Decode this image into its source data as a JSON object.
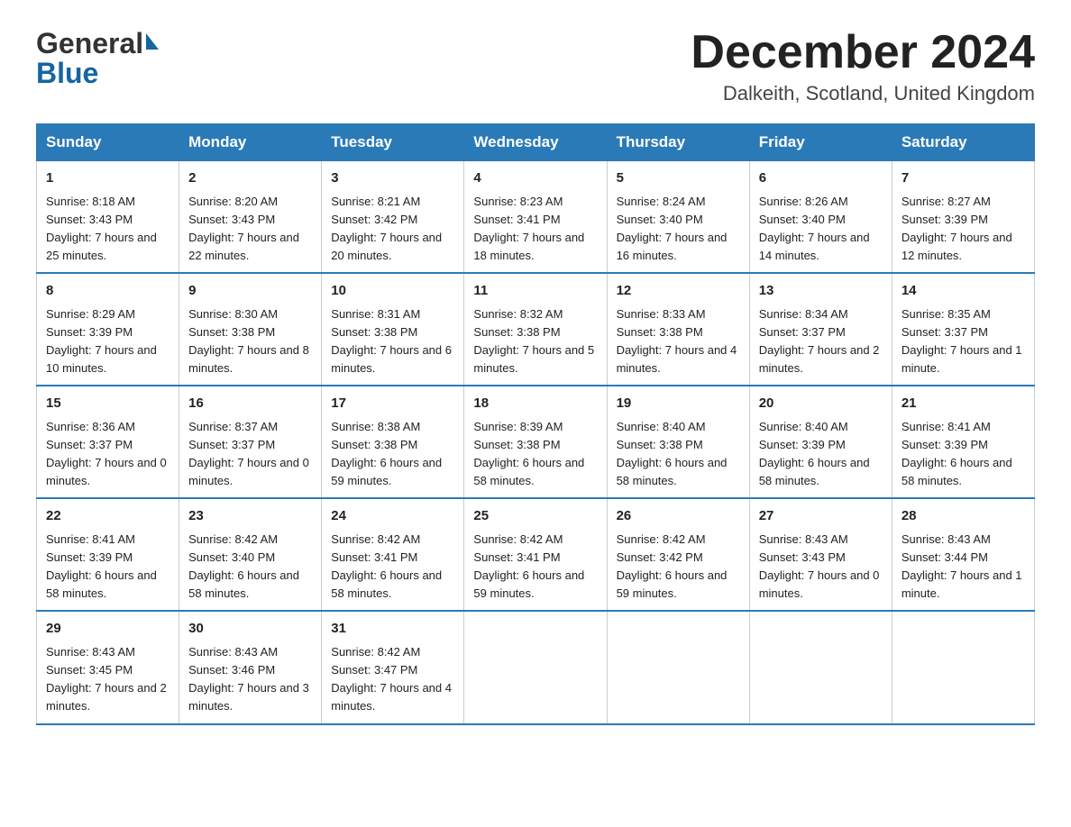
{
  "header": {
    "logo_general": "General",
    "logo_blue": "Blue",
    "month_title": "December 2024",
    "location": "Dalkeith, Scotland, United Kingdom"
  },
  "days_of_week": [
    "Sunday",
    "Monday",
    "Tuesday",
    "Wednesday",
    "Thursday",
    "Friday",
    "Saturday"
  ],
  "weeks": [
    [
      {
        "day": "1",
        "sunrise": "8:18 AM",
        "sunset": "3:43 PM",
        "daylight": "7 hours and 25 minutes."
      },
      {
        "day": "2",
        "sunrise": "8:20 AM",
        "sunset": "3:43 PM",
        "daylight": "7 hours and 22 minutes."
      },
      {
        "day": "3",
        "sunrise": "8:21 AM",
        "sunset": "3:42 PM",
        "daylight": "7 hours and 20 minutes."
      },
      {
        "day": "4",
        "sunrise": "8:23 AM",
        "sunset": "3:41 PM",
        "daylight": "7 hours and 18 minutes."
      },
      {
        "day": "5",
        "sunrise": "8:24 AM",
        "sunset": "3:40 PM",
        "daylight": "7 hours and 16 minutes."
      },
      {
        "day": "6",
        "sunrise": "8:26 AM",
        "sunset": "3:40 PM",
        "daylight": "7 hours and 14 minutes."
      },
      {
        "day": "7",
        "sunrise": "8:27 AM",
        "sunset": "3:39 PM",
        "daylight": "7 hours and 12 minutes."
      }
    ],
    [
      {
        "day": "8",
        "sunrise": "8:29 AM",
        "sunset": "3:39 PM",
        "daylight": "7 hours and 10 minutes."
      },
      {
        "day": "9",
        "sunrise": "8:30 AM",
        "sunset": "3:38 PM",
        "daylight": "7 hours and 8 minutes."
      },
      {
        "day": "10",
        "sunrise": "8:31 AM",
        "sunset": "3:38 PM",
        "daylight": "7 hours and 6 minutes."
      },
      {
        "day": "11",
        "sunrise": "8:32 AM",
        "sunset": "3:38 PM",
        "daylight": "7 hours and 5 minutes."
      },
      {
        "day": "12",
        "sunrise": "8:33 AM",
        "sunset": "3:38 PM",
        "daylight": "7 hours and 4 minutes."
      },
      {
        "day": "13",
        "sunrise": "8:34 AM",
        "sunset": "3:37 PM",
        "daylight": "7 hours and 2 minutes."
      },
      {
        "day": "14",
        "sunrise": "8:35 AM",
        "sunset": "3:37 PM",
        "daylight": "7 hours and 1 minute."
      }
    ],
    [
      {
        "day": "15",
        "sunrise": "8:36 AM",
        "sunset": "3:37 PM",
        "daylight": "7 hours and 0 minutes."
      },
      {
        "day": "16",
        "sunrise": "8:37 AM",
        "sunset": "3:37 PM",
        "daylight": "7 hours and 0 minutes."
      },
      {
        "day": "17",
        "sunrise": "8:38 AM",
        "sunset": "3:38 PM",
        "daylight": "6 hours and 59 minutes."
      },
      {
        "day": "18",
        "sunrise": "8:39 AM",
        "sunset": "3:38 PM",
        "daylight": "6 hours and 58 minutes."
      },
      {
        "day": "19",
        "sunrise": "8:40 AM",
        "sunset": "3:38 PM",
        "daylight": "6 hours and 58 minutes."
      },
      {
        "day": "20",
        "sunrise": "8:40 AM",
        "sunset": "3:39 PM",
        "daylight": "6 hours and 58 minutes."
      },
      {
        "day": "21",
        "sunrise": "8:41 AM",
        "sunset": "3:39 PM",
        "daylight": "6 hours and 58 minutes."
      }
    ],
    [
      {
        "day": "22",
        "sunrise": "8:41 AM",
        "sunset": "3:39 PM",
        "daylight": "6 hours and 58 minutes."
      },
      {
        "day": "23",
        "sunrise": "8:42 AM",
        "sunset": "3:40 PM",
        "daylight": "6 hours and 58 minutes."
      },
      {
        "day": "24",
        "sunrise": "8:42 AM",
        "sunset": "3:41 PM",
        "daylight": "6 hours and 58 minutes."
      },
      {
        "day": "25",
        "sunrise": "8:42 AM",
        "sunset": "3:41 PM",
        "daylight": "6 hours and 59 minutes."
      },
      {
        "day": "26",
        "sunrise": "8:42 AM",
        "sunset": "3:42 PM",
        "daylight": "6 hours and 59 minutes."
      },
      {
        "day": "27",
        "sunrise": "8:43 AM",
        "sunset": "3:43 PM",
        "daylight": "7 hours and 0 minutes."
      },
      {
        "day": "28",
        "sunrise": "8:43 AM",
        "sunset": "3:44 PM",
        "daylight": "7 hours and 1 minute."
      }
    ],
    [
      {
        "day": "29",
        "sunrise": "8:43 AM",
        "sunset": "3:45 PM",
        "daylight": "7 hours and 2 minutes."
      },
      {
        "day": "30",
        "sunrise": "8:43 AM",
        "sunset": "3:46 PM",
        "daylight": "7 hours and 3 minutes."
      },
      {
        "day": "31",
        "sunrise": "8:42 AM",
        "sunset": "3:47 PM",
        "daylight": "7 hours and 4 minutes."
      },
      null,
      null,
      null,
      null
    ]
  ]
}
